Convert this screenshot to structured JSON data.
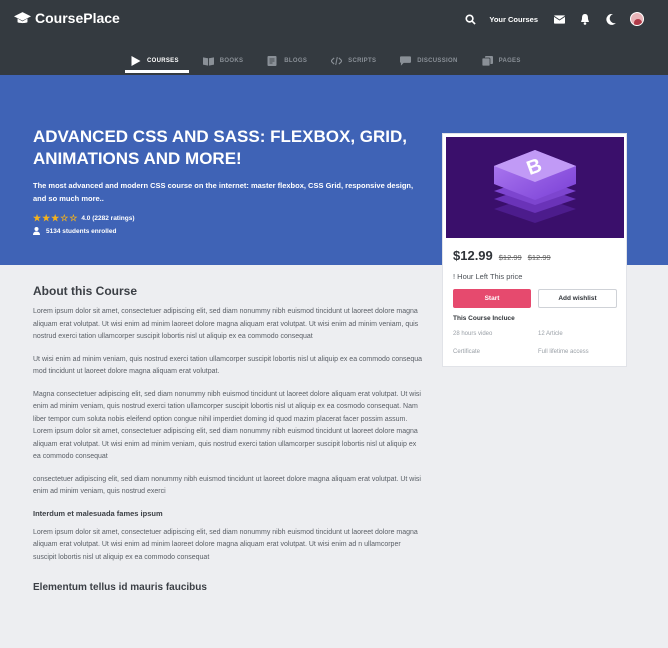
{
  "brand": {
    "name": "CoursePlace",
    "icon": "graduation-cap-icon"
  },
  "topbar": {
    "your_courses": "Your Courses",
    "icons": [
      "search-icon",
      "mail-icon",
      "bell-icon",
      "moon-icon",
      "avatar"
    ]
  },
  "nav": {
    "items": [
      {
        "label": "COURSES",
        "icon": "play-icon",
        "active": true
      },
      {
        "label": "BOOKS",
        "icon": "book-icon",
        "active": false
      },
      {
        "label": "BLOGS",
        "icon": "blog-icon",
        "active": false
      },
      {
        "label": "SCRIPTS",
        "icon": "code-icon",
        "active": false
      },
      {
        "label": "DISCUSSION",
        "icon": "chat-icon",
        "active": false
      },
      {
        "label": "PAGES",
        "icon": "pages-icon",
        "active": false
      }
    ]
  },
  "hero": {
    "title": "ADVANCED CSS AND SASS: FLEXBOX, GRID, ANIMATIONS AND MORE!",
    "description": "The most advanced and modern CSS course on the internet: master flexbox, CSS Grid, responsive design, and so much more..",
    "rating_text": "4.0 (2282 ratings)",
    "rating_value": 4.0,
    "rating_max": 5,
    "students": "5134 students enrolled",
    "bg_color": "#3f63b6"
  },
  "card": {
    "price": "$12.99",
    "old_price_1": "$12.99",
    "old_price_2": "$12.99",
    "hours_left": "! Hour Left This price",
    "start_label": "Start",
    "wishlist_label": "Add wishlist",
    "includes_title": "This Course Incluce",
    "includes": [
      "28 hours video",
      "12 Article",
      "Certificate",
      "Full lifetime access"
    ],
    "accent": "#e64a6e",
    "image_icon": "bootstrap-logo-icon"
  },
  "content": {
    "heading": "About this Course",
    "p1": "Lorem ipsum dolor sit amet, consectetuer adipiscing elit, sed diam nonummy nibh euismod tincidunt ut laoreet dolore magna aliquam erat volutpat. Ut wisi enim ad minim laoreet dolore magna aliquam erat volutpat. Ut wisi enim ad minim veniam, quis nostrud exerci tation ullamcorper suscipit lobortis nisl ut aliquip ex ea commodo consequat",
    "p2": "Ut wisi enim ad minim veniam, quis nostrud exerci tation ullamcorper suscipit lobortis nisl ut aliquip ex ea commodo consequa mod tincidunt ut laoreet dolore magna aliquam erat volutpat.",
    "p3": "Magna consectetuer adipiscing elit, sed diam nonummy nibh euismod tincidunt ut laoreet dolore aliquam erat volutpat. Ut wisi enim ad minim veniam, quis nostrud exerci tation ullamcorper suscipit lobortis nisl ut aliquip ex ea cosmodo consequat. Nam liber tempor cum soluta nobis eleifend option congue nihil imperdiet doming id quod mazim placerat facer possim assum. Lorem ipsum dolor sit amet, consectetuer adipiscing elit, sed diam nonummy nibh euismod tincidunt ut laoreet dolore magna aliquam erat volutpat. Ut wisi enim ad minim veniam, quis nostrud exerci tation ullamcorper suscipit lobortis nisl ut aliquip ex ea commodo consequat",
    "p4": "consectetuer adipiscing elit, sed diam nonummy nibh euismod tincidunt ut laoreet dolore magna aliquam erat volutpat. Ut wisi enim ad minim veniam, quis nostrud exerci",
    "subheading": "Interdum et malesuada fames ipsum",
    "p5": "Lorem ipsum dolor sit amet, consectetuer adipiscing elit, sed diam nonummy nibh euismod tincidunt ut laoreet dolore magna aliquam erat volutpat. Ut wisi enim ad minim laoreet dolore magna aliquam erat volutpat. Ut wisi enim ad n ullamcorper suscipit lobortis nisl ut aliquip ex ea commodo consequat",
    "heading2": "Elementum tellus id mauris faucibus"
  }
}
